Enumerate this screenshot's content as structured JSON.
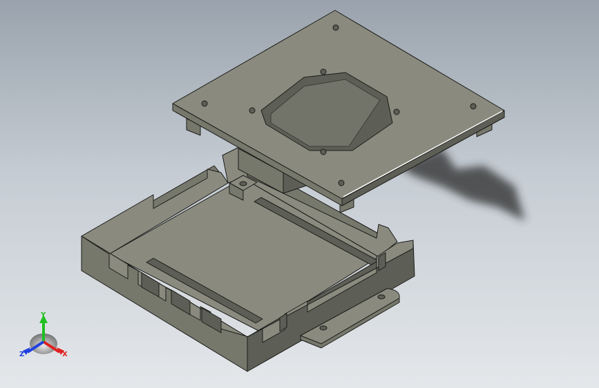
{
  "viewport": {
    "background_top": "#9aa3ad",
    "background_bottom": "#e4e7ea"
  },
  "model": {
    "face_top_color": "#8a8b7e",
    "face_side_color": "#77786c",
    "face_dark_color": "#5d5e55",
    "edge_color": "#1c1c1a",
    "shadow_color": "#2b2b2b"
  },
  "triad": {
    "labels": {
      "x": "X",
      "y": "Y",
      "z": "Z"
    },
    "colors": {
      "x": "#e02020",
      "y": "#20c020",
      "z": "#2040e0"
    }
  }
}
